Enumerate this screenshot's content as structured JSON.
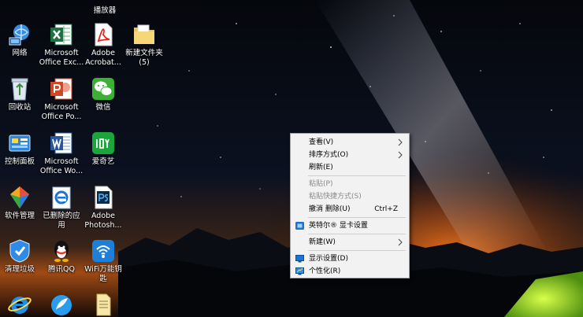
{
  "desktop": {
    "top_partial_label": "播放器",
    "icons": [
      {
        "label": "网络",
        "icon": "network-icon"
      },
      {
        "label": "Microsoft\nOffice Exc...",
        "icon": "excel-icon"
      },
      {
        "label": "Adobe\nAcrobat...",
        "icon": "acrobat-icon"
      },
      {
        "label": "新建文件夹\n(5)",
        "icon": "folder-icon"
      },
      {
        "label": "回收站",
        "icon": "recycle-bin-icon"
      },
      {
        "label": "Microsoft\nOffice Po...",
        "icon": "powerpoint-icon"
      },
      {
        "label": "微信",
        "icon": "wechat-icon"
      },
      {
        "label": "控制面板",
        "icon": "control-panel-icon"
      },
      {
        "label": "Microsoft\nOffice Wo...",
        "icon": "word-icon"
      },
      {
        "label": "爱奇艺",
        "icon": "iqiyi-icon"
      },
      {
        "label": "软件管理",
        "icon": "software-manager-icon"
      },
      {
        "label": "已删除的应\n用",
        "icon": "edge-icon"
      },
      {
        "label": "Adobe\nPhotosh...",
        "icon": "photoshop-icon"
      },
      {
        "label": "清理垃圾",
        "icon": "cleanup-icon"
      },
      {
        "label": "腾讯QQ",
        "icon": "qq-icon"
      },
      {
        "label": "WiFi万能钥\n匙",
        "icon": "wifi-key-icon"
      },
      {
        "label": "",
        "icon": "ie-icon"
      },
      {
        "label": "",
        "icon": "feather-app-icon"
      },
      {
        "label": "",
        "icon": "document-shortcut-icon"
      }
    ]
  },
  "context_menu": {
    "items": [
      {
        "label": "查看(V)",
        "submenu": true
      },
      {
        "label": "排序方式(O)",
        "submenu": true
      },
      {
        "label": "刷新(E)"
      },
      {
        "separator": true
      },
      {
        "label": "粘贴(P)",
        "disabled": true
      },
      {
        "label": "粘贴快捷方式(S)",
        "disabled": true
      },
      {
        "label": "撤消 删除(U)",
        "shortcut": "Ctrl+Z"
      },
      {
        "separator": true
      },
      {
        "label": "英特尔® 显卡设置",
        "icon": "intel-graphics-icon"
      },
      {
        "separator": true
      },
      {
        "label": "新建(W)",
        "submenu": true
      },
      {
        "separator": true
      },
      {
        "label": "显示设置(D)",
        "icon": "display-settings-icon"
      },
      {
        "label": "个性化(R)",
        "icon": "personalize-icon"
      }
    ]
  },
  "colors": {
    "menu_bg": "#f2f2f2",
    "disabled_text": "#8a8a8a",
    "accent_blue": "#1e73d2"
  }
}
